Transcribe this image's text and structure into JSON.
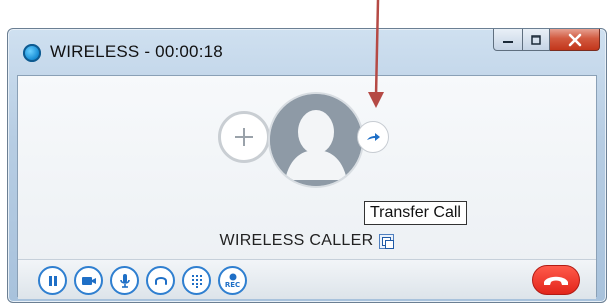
{
  "window": {
    "title": "WIRELESS - 00:00:18"
  },
  "call": {
    "caller_name": "WIRELESS CALLER",
    "tooltip": "Transfer Call"
  },
  "toolbar": {
    "buttons": [
      {
        "name": "pause",
        "icon": "pause-icon"
      },
      {
        "name": "video",
        "icon": "video-camera-icon"
      },
      {
        "name": "mute",
        "icon": "microphone-icon"
      },
      {
        "name": "headset",
        "icon": "headset-icon"
      },
      {
        "name": "keypad",
        "icon": "dialpad-icon"
      },
      {
        "name": "record",
        "icon": "record-icon",
        "label": "REC"
      }
    ]
  },
  "colors": {
    "accent_blue": "#2f7fd0",
    "hangup_red": "#e2251b",
    "annotation_arrow": "#b54a45"
  }
}
